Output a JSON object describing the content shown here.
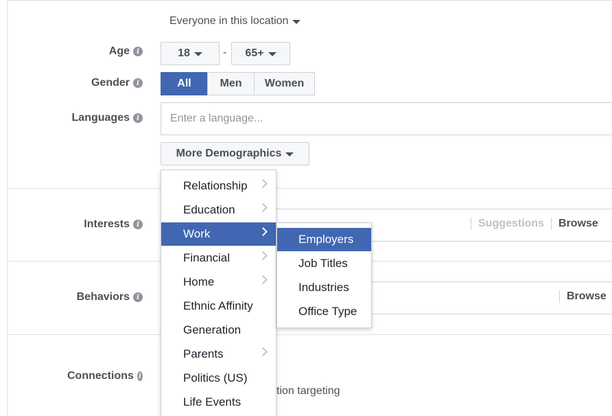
{
  "location": {
    "selected": "Everyone in this location"
  },
  "age": {
    "label": "Age",
    "min": "18",
    "separator": "-",
    "max": "65+"
  },
  "gender": {
    "label": "Gender",
    "options": [
      "All",
      "Men",
      "Women"
    ],
    "selected": "All"
  },
  "languages": {
    "label": "Languages",
    "placeholder": "Enter a language..."
  },
  "more_demographics": {
    "label": "More Demographics"
  },
  "interests": {
    "label": "Interests",
    "suggestions": "Suggestions",
    "browse": "Browse"
  },
  "behaviors": {
    "label": "Behaviors",
    "browse": "Browse"
  },
  "connections": {
    "label": "Connections",
    "partial_text": "tion targeting"
  },
  "demographics_menu": {
    "items": [
      {
        "label": "Relationship",
        "has_submenu": true
      },
      {
        "label": "Education",
        "has_submenu": true
      },
      {
        "label": "Work",
        "has_submenu": true,
        "active": true
      },
      {
        "label": "Financial",
        "has_submenu": true
      },
      {
        "label": "Home",
        "has_submenu": true
      },
      {
        "label": "Ethnic Affinity",
        "has_submenu": false
      },
      {
        "label": "Generation",
        "has_submenu": false
      },
      {
        "label": "Parents",
        "has_submenu": true
      },
      {
        "label": "Politics (US)",
        "has_submenu": false
      },
      {
        "label": "Life Events",
        "has_submenu": false
      }
    ]
  },
  "work_submenu": {
    "items": [
      {
        "label": "Employers",
        "active": true
      },
      {
        "label": "Job Titles"
      },
      {
        "label": "Industries"
      },
      {
        "label": "Office Type"
      }
    ]
  },
  "colors": {
    "accent": "#4267b2",
    "border": "#ccd0d5",
    "text": "#4b4f56",
    "muted": "#bec2c9"
  },
  "icons": {
    "info": "info-icon",
    "caret": "caret-down-icon",
    "chevron": "chevron-right-icon"
  }
}
